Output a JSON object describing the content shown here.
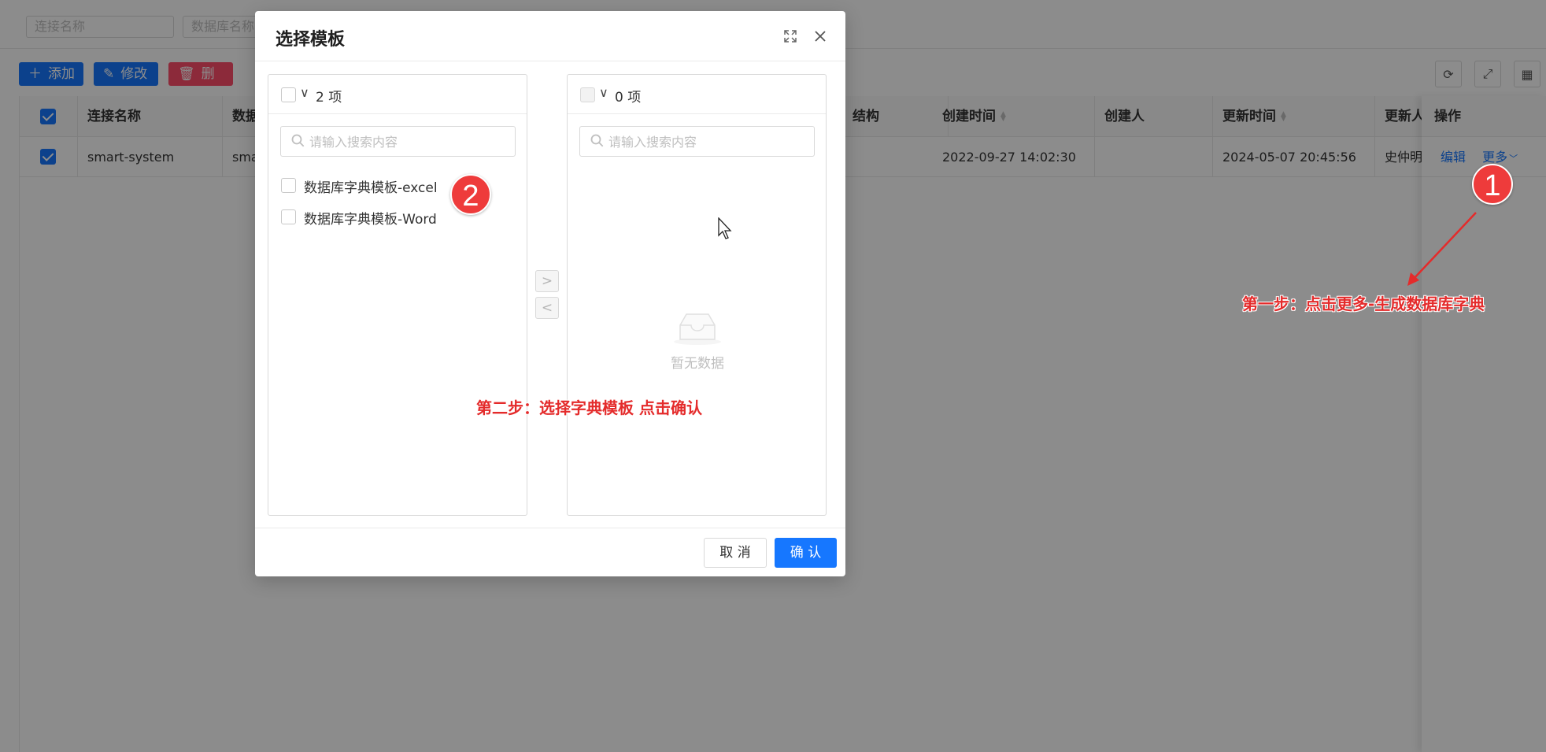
{
  "filters": {
    "connection_name_placeholder": "连接名称",
    "database_name_placeholder": "数据库名称"
  },
  "toolbar": {
    "add_label": "添加",
    "edit_label": "修改",
    "delete_label": "删除",
    "icons": [
      "refresh-icon",
      "fullscreen-icon",
      "column-settings-icon"
    ]
  },
  "table": {
    "headers": {
      "connection_name": "连接名称",
      "db_partial": "数据",
      "struct_partial": "结构",
      "create_time": "创建时间",
      "creator": "创建人",
      "update_time": "更新时间",
      "updater": "更新人",
      "operation": "操作"
    },
    "row": {
      "checked": true,
      "connection_name": "smart-system",
      "db_partial": "sma",
      "create_time": "2022-09-27 14:02:30",
      "creator": "",
      "update_time": "2024-05-07 20:45:56",
      "updater": "史仲明",
      "edit_link": "编辑",
      "more_link": "更多"
    }
  },
  "modal": {
    "title": "选择模板",
    "left_panel": {
      "count_label": "2 项",
      "search_placeholder": "请输入搜索内容",
      "items": [
        {
          "label": "数据库字典模板-excel",
          "checked": false
        },
        {
          "label": "数据库字典模板-Word",
          "checked": false
        }
      ]
    },
    "right_panel": {
      "count_label": "0 项",
      "search_placeholder": "请输入搜索内容",
      "empty_text": "暂无数据"
    },
    "move_right_label": ">",
    "move_left_label": "<",
    "cancel_label": "取 消",
    "confirm_label": "确 认"
  },
  "annotations": {
    "badge_1": "1",
    "badge_2": "2",
    "step_1": "第一步：点击更多-生成数据库字典",
    "step_2": "第二步：选择字典模板 点击确认"
  },
  "colors": {
    "primary": "#1677ff",
    "danger": "#ff4d6a",
    "annotation_red": "#e42b2b"
  }
}
